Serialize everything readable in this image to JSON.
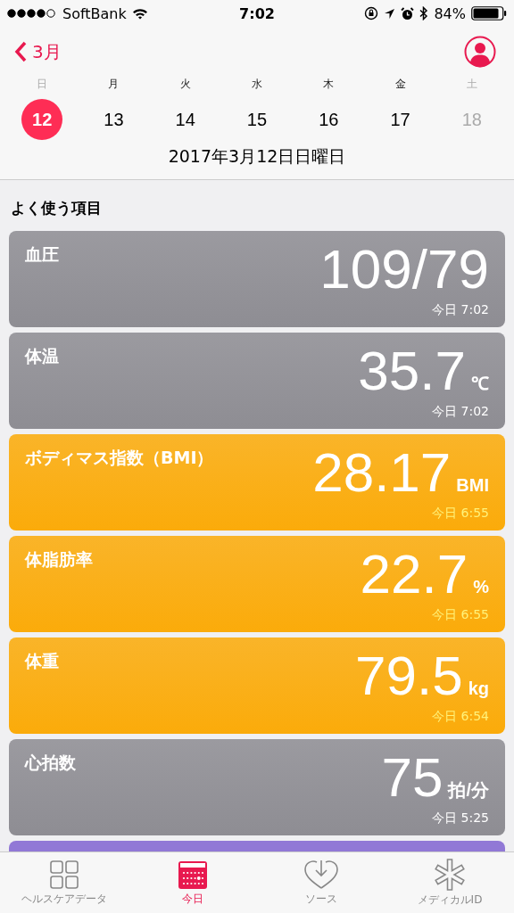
{
  "status_bar": {
    "carrier": "SoftBank",
    "time": "7:02",
    "battery": "84%"
  },
  "nav": {
    "back_label": "3月"
  },
  "days": [
    {
      "weekday": "日",
      "date": "12",
      "selected": true,
      "weekend": true,
      "disabled": false
    },
    {
      "weekday": "月",
      "date": "13",
      "selected": false,
      "weekend": false,
      "disabled": false
    },
    {
      "weekday": "火",
      "date": "14",
      "selected": false,
      "weekend": false,
      "disabled": false
    },
    {
      "weekday": "水",
      "date": "15",
      "selected": false,
      "weekend": false,
      "disabled": false
    },
    {
      "weekday": "木",
      "date": "16",
      "selected": false,
      "weekend": false,
      "disabled": false
    },
    {
      "weekday": "金",
      "date": "17",
      "selected": false,
      "weekend": false,
      "disabled": false
    },
    {
      "weekday": "土",
      "date": "18",
      "selected": false,
      "weekend": true,
      "disabled": true
    }
  ],
  "full_date": "2017年3月12日日曜日",
  "section_title": "よく使う項目",
  "cards": [
    {
      "title": "血圧",
      "value": "109/79",
      "time": "今日 7:02",
      "color": "#8e8d93"
    },
    {
      "title": "体温",
      "value": "35.7",
      "unit": "℃",
      "time": "今日 7:02",
      "color": "#8e8d93"
    },
    {
      "title": "ボディマス指数（BMI）",
      "value": "28.17",
      "unit": "BMI",
      "time": "今日 6:55",
      "color": "#fbab0a"
    },
    {
      "title": "体脂肪率",
      "value": "22.7",
      "unit": "%",
      "time": "今日 6:55",
      "color": "#fbab0a"
    },
    {
      "title": "体重",
      "value": "79.5",
      "unit": "kg",
      "time": "今日 6:54",
      "color": "#fbab0a"
    },
    {
      "title": "心拍数",
      "value": "75",
      "unit": "拍/分",
      "time": "今日 5:25",
      "color": "#8e8d93"
    },
    {
      "color": "#9178d6"
    }
  ],
  "tabs": [
    {
      "kind": "grid",
      "label": "ヘルスケアデータ",
      "selected": false
    },
    {
      "kind": "calendar",
      "label": "今日",
      "selected": true
    },
    {
      "kind": "heart",
      "label": "ソース",
      "selected": false
    },
    {
      "kind": "asterisk",
      "label": "メディカルID",
      "selected": false
    }
  ]
}
